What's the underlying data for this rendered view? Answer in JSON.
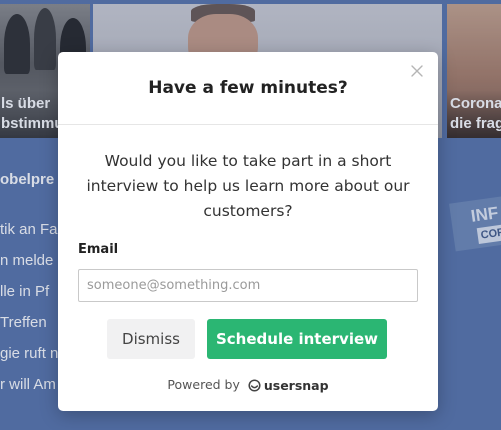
{
  "background": {
    "cards": [
      {
        "caption_lines": [
          "ls über",
          "bstimmu"
        ]
      },
      {
        "caption_lines": []
      },
      {
        "caption_lines": [
          "Corona",
          "die frag"
        ]
      }
    ],
    "section_heading": "obelpre",
    "headlines": [
      "tik an Fa",
      "n melde",
      "lle in Pf",
      "Treffen",
      "gie ruft n",
      "r will Am"
    ],
    "info_badge": {
      "line1": "INF",
      "line2": "COR"
    }
  },
  "modal": {
    "title": "Have a few minutes?",
    "body": "Would you like to take part in a short interview to help us learn more about our customers?",
    "email_label": "Email",
    "email_placeholder": "someone@something.com",
    "email_value": "",
    "dismiss_label": "Dismiss",
    "schedule_label": "Schedule interview",
    "powered_by": "Powered by",
    "brand": "usersnap",
    "close_icon": "close-icon",
    "brand_icon": "usersnap-logo-icon"
  },
  "colors": {
    "page_bg": "#5a76ab",
    "primary_button": "#2bb673",
    "secondary_button": "#f1f1f2"
  }
}
